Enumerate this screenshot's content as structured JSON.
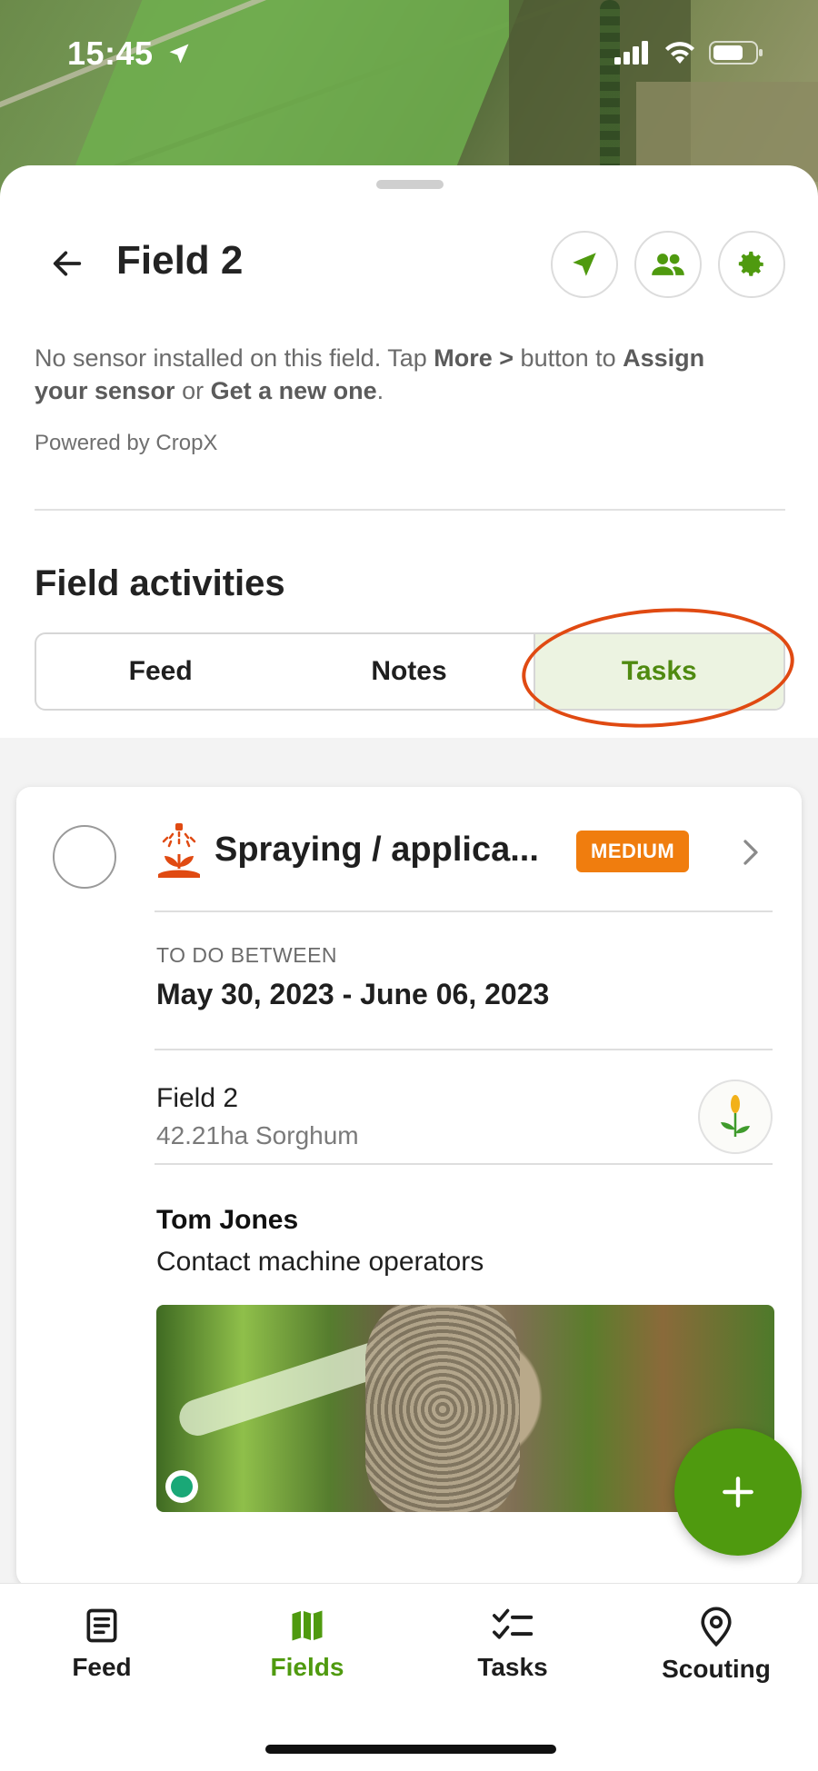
{
  "status_bar": {
    "time": "15:45"
  },
  "header": {
    "title": "Field 2",
    "back_icon": "arrow-left-icon",
    "actions": [
      "navigate-icon",
      "users-icon",
      "gear-icon"
    ]
  },
  "sensor_info": {
    "part1": "No sensor installed on this field. Tap ",
    "more": "More >",
    "part2": " button to ",
    "assign": "Assign your sensor",
    "part3": " or ",
    "get_new": "Get a new one",
    "part4": "."
  },
  "powered_by": "Powered by CropX",
  "activities": {
    "title": "Field activities",
    "tabs": [
      "Feed",
      "Notes",
      "Tasks"
    ],
    "active_tab": "Tasks"
  },
  "task": {
    "title": "Spraying / applica...",
    "priority": "MEDIUM",
    "todo_label": "TO DO BETWEEN",
    "date_range": "May 30, 2023 - June 06, 2023",
    "field_name": "Field 2",
    "field_meta": "42.21ha Sorghum",
    "assignee": "Tom Jones",
    "description": "Contact machine operators"
  },
  "bottom_nav": {
    "items": [
      {
        "label": "Feed",
        "icon": "document-icon"
      },
      {
        "label": "Fields",
        "icon": "map-icon"
      },
      {
        "label": "Tasks",
        "icon": "checklist-icon"
      },
      {
        "label": "Scouting",
        "icon": "location-pin-icon"
      }
    ],
    "active": "Fields"
  },
  "colors": {
    "brand_green": "#4f9a0f",
    "priority_orange": "#f07d0e",
    "annotation_red": "#e04a12"
  }
}
